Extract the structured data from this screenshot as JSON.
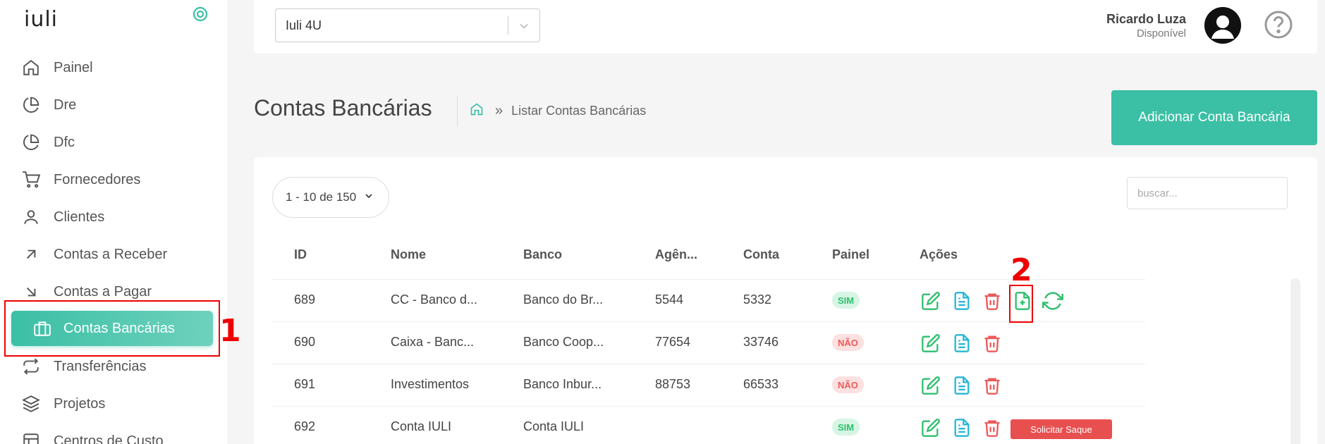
{
  "app": {
    "logo_text": "iuli"
  },
  "sidebar": {
    "items": [
      {
        "label": "Painel",
        "icon": "home-icon"
      },
      {
        "label": "Dre",
        "icon": "pie-chart-icon"
      },
      {
        "label": "Dfc",
        "icon": "pie-chart-icon"
      },
      {
        "label": "Fornecedores",
        "icon": "shopping-cart-icon"
      },
      {
        "label": "Clientes",
        "icon": "user-icon"
      },
      {
        "label": "Contas a Receber",
        "icon": "arrow-up-right-icon"
      },
      {
        "label": "Contas a Pagar",
        "icon": "arrow-down-right-icon"
      },
      {
        "label": "Contas Bancárias",
        "icon": "briefcase-icon",
        "active": true
      },
      {
        "label": "Transferências",
        "icon": "repeat-icon"
      },
      {
        "label": "Projetos",
        "icon": "layers-icon"
      },
      {
        "label": "Centros de Custo",
        "icon": "layout-icon"
      }
    ]
  },
  "topbar": {
    "company_select": "Iuli 4U",
    "user_name": "Ricardo Luza",
    "user_status": "Disponível"
  },
  "page": {
    "title": "Contas Bancárias",
    "breadcrumb_separator": "»",
    "breadcrumb_current": "Listar Contas Bancárias",
    "add_button": "Adicionar Conta Bancária"
  },
  "table": {
    "pager": "1 - 10 de 150",
    "search_placeholder": "buscar...",
    "columns": [
      "ID",
      "Nome",
      "Banco",
      "Agên...",
      "Conta",
      "Painel",
      "Ações"
    ],
    "rows": [
      {
        "id": "689",
        "nome": "CC - Banco d...",
        "banco": "Banco do Br...",
        "agencia": "5544",
        "conta": "5332",
        "painel": "SIM"
      },
      {
        "id": "690",
        "nome": "Caixa - Banc...",
        "banco": "Banco Coop...",
        "agencia": "77654",
        "conta": "33746",
        "painel": "NÃO"
      },
      {
        "id": "691",
        "nome": "Investimentos",
        "banco": "Banco Inbur...",
        "agencia": "88753",
        "conta": "66533",
        "painel": "NÃO"
      },
      {
        "id": "692",
        "nome": "Conta IULI",
        "banco": "Conta IULI",
        "agencia": "",
        "conta": "",
        "painel": "SIM",
        "saque_label": "Solicitar Saque"
      }
    ]
  },
  "annotations": {
    "first": "1",
    "second": "2"
  },
  "colors": {
    "accent": "#3bbfa5",
    "edit": "#2fbf6f",
    "doc": "#29b6d6",
    "delete": "#ec5a5a",
    "annotation": "#ee0000"
  }
}
